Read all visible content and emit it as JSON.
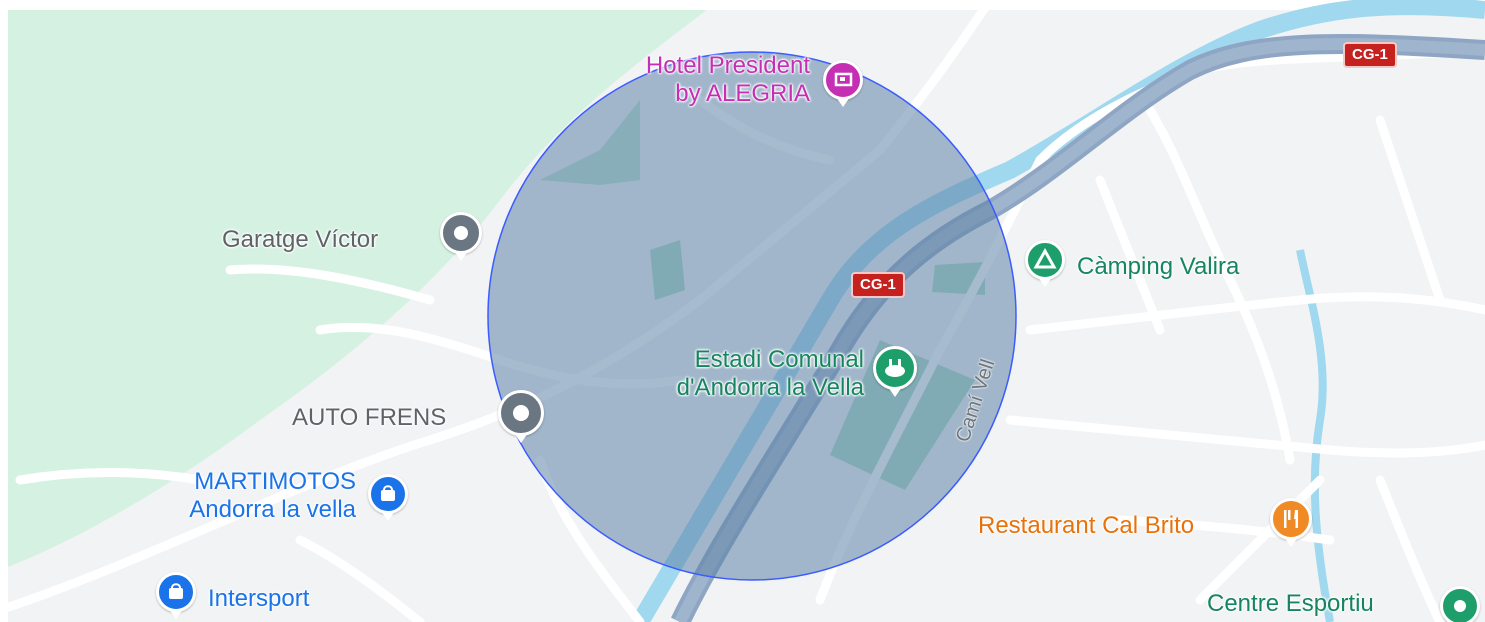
{
  "map": {
    "colors": {
      "land": "#f1f3f4",
      "forest": "#d4f1e2",
      "park": "#a8dcc3",
      "road": "#ffffff",
      "road_outline": "#dadce0",
      "highway": "#8ea6c3",
      "river": "#9fd8ef",
      "circle_fill": "#5f83a8",
      "circle_stroke": "#3b5cff"
    },
    "road_labels": {
      "cg1_top": "CG-1",
      "cg1_center": "CG-1",
      "cami_vell": "Camí Vell"
    },
    "places": [
      {
        "id": "hotel",
        "name_line1": "Hotel President",
        "name_line2": "by ALEGRIA",
        "icon": "hotel-icon",
        "color": "#c52fb4"
      },
      {
        "id": "garatge",
        "name": "Garatge Víctor",
        "icon": "map-pin-icon",
        "color": "#6a7681"
      },
      {
        "id": "camping",
        "name": "Càmping Valira",
        "icon": "camping-tent-icon",
        "color": "#1e9e6a"
      },
      {
        "id": "estadi",
        "name_line1": "Estadi Comunal",
        "name_line2": "d'Andorra la Vella",
        "icon": "stadium-icon",
        "color": "#1e9e6a"
      },
      {
        "id": "autofrens",
        "name": "AUTO FRENS",
        "icon": "map-pin-icon",
        "color": "#6a7681"
      },
      {
        "id": "martimotos",
        "name_line1": "MARTIMOTOS",
        "name_line2": "Andorra la vella",
        "icon": "shopping-bag-icon",
        "color": "#1a73e8"
      },
      {
        "id": "intersport",
        "name": "Intersport",
        "icon": "shopping-bag-icon",
        "color": "#1a73e8"
      },
      {
        "id": "calbrito",
        "name": "Restaurant Cal Brito",
        "icon": "restaurant-icon",
        "color": "#f08a24"
      },
      {
        "id": "centre",
        "name": "Centre Esportiu",
        "icon": "sport-icon",
        "color": "#1e9e6a"
      }
    ]
  }
}
